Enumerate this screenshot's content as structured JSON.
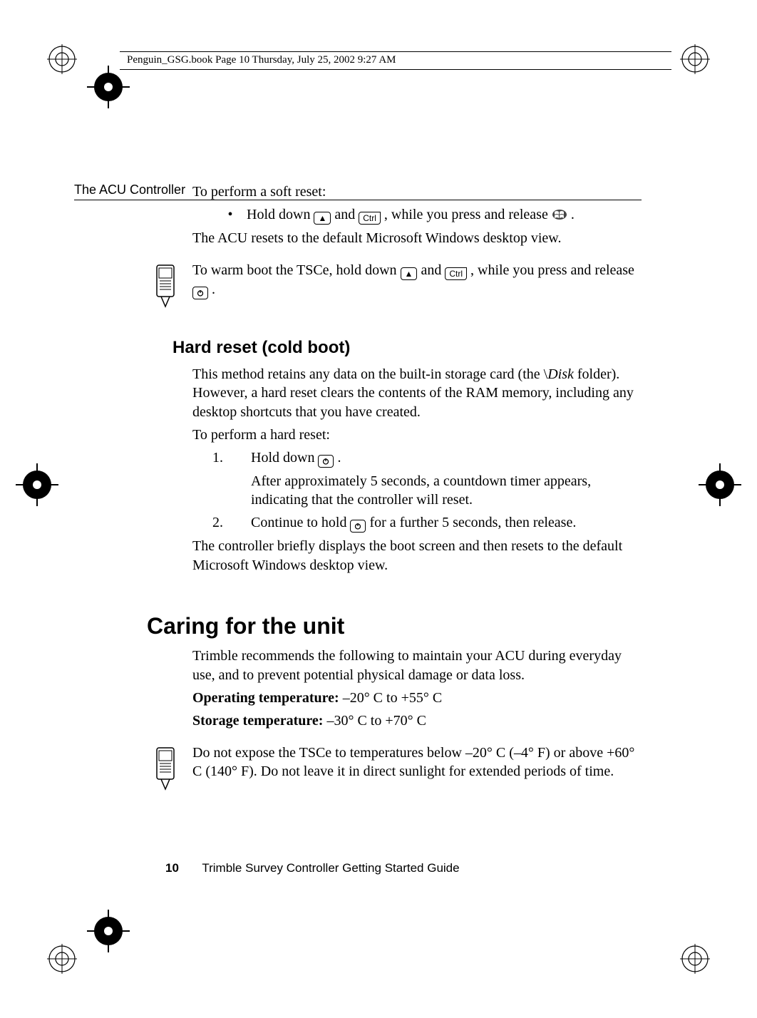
{
  "meta": {
    "line": "Penguin_GSG.book  Page 10  Thursday, July 25, 2002  9:27 AM"
  },
  "running_head": "The ACU Controller",
  "soft_reset": {
    "intro": "To perform a soft reset:",
    "bullet_pre": "Hold down ",
    "bullet_mid1": " and ",
    "bullet_mid2": ", while you press and release ",
    "bullet_end": ".",
    "result": "The ACU resets to the default Microsoft Windows desktop view."
  },
  "tsce_note": {
    "pre": "To warm boot the TSCe, hold down ",
    "mid1": " and ",
    "mid2": ", while you press and release ",
    "end": "."
  },
  "hard_reset": {
    "heading": "Hard reset (cold boot)",
    "p1a": "This method retains any data on the built-in storage card (the \\",
    "p1b": "Disk",
    "p1c": " folder). However, a hard reset clears the contents of the RAM memory, including any desktop shortcuts that you have created.",
    "p2": "To perform a hard reset:",
    "step1_pre": "Hold down ",
    "step1_end": ".",
    "step1_sub": "After approximately 5 seconds, a countdown timer appears, indicating that the controller will reset.",
    "step2_pre": "Continue to hold ",
    "step2_end": " for a further 5 seconds, then release.",
    "p3": "The controller briefly displays the boot screen and then resets to the default Microsoft Windows desktop view."
  },
  "caring": {
    "heading": "Caring for the unit",
    "p1": "Trimble recommends the following to maintain your ACU during everyday use, and to prevent potential physical damage or data loss.",
    "op_label": "Operating temperature:",
    "op_val": " –20° C to +55° C",
    "st_label": "Storage temperature:",
    "st_val": " –30° C to +70° C",
    "note": "Do not expose the TSCe to temperatures below –20° C (–4° F) or above +60° C (140° F). Do not leave it in direct sunlight for extended periods of time."
  },
  "keys": {
    "shift_glyph": "▲",
    "ctrl_label": "Ctrl"
  },
  "footer": {
    "page": "10",
    "title": "Trimble Survey Controller Getting Started Guide"
  }
}
